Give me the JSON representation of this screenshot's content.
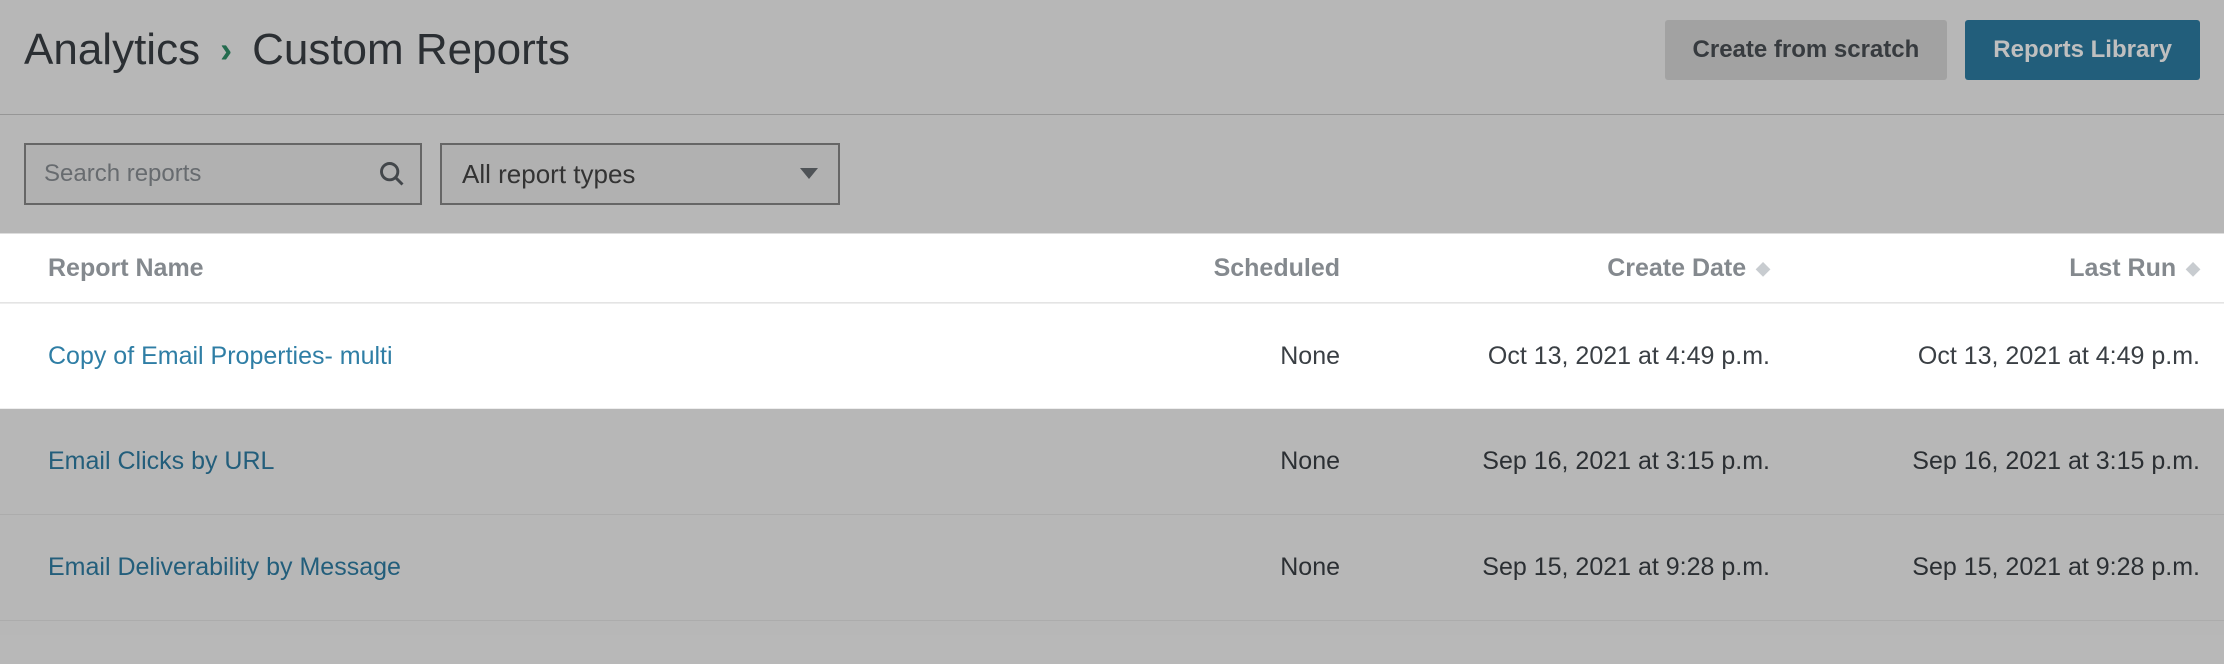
{
  "breadcrumb": {
    "root": "Analytics",
    "current": "Custom Reports"
  },
  "header": {
    "create_label": "Create from scratch",
    "library_label": "Reports Library"
  },
  "filters": {
    "search_placeholder": "Search reports",
    "type_select_label": "All report types"
  },
  "table": {
    "columns": {
      "name": "Report Name",
      "scheduled": "Scheduled",
      "create_date": "Create Date",
      "last_run": "Last Run"
    },
    "rows": [
      {
        "name": "Copy of Email Properties- multi",
        "scheduled": "None",
        "create_date": "Oct 13, 2021 at 4:49 p.m.",
        "last_run": "Oct 13, 2021 at 4:49 p.m.",
        "highlight": true
      },
      {
        "name": "Email Clicks by URL",
        "scheduled": "None",
        "create_date": "Sep 16, 2021 at 3:15 p.m.",
        "last_run": "Sep 16, 2021 at 3:15 p.m.",
        "highlight": false
      },
      {
        "name": "Email Deliverability by Message",
        "scheduled": "None",
        "create_date": "Sep 15, 2021 at 9:28 p.m.",
        "last_run": "Sep 15, 2021 at 9:28 p.m.",
        "highlight": false
      }
    ]
  }
}
